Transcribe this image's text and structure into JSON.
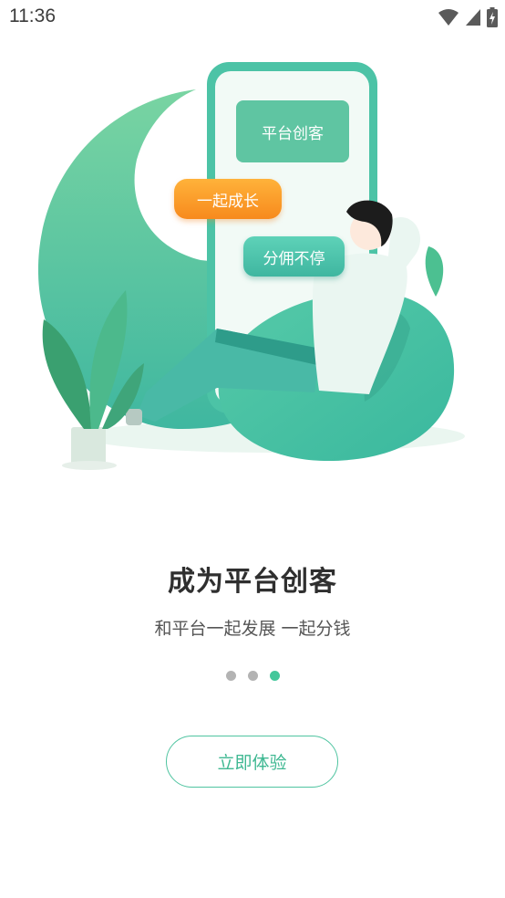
{
  "status_bar": {
    "time": "11:36"
  },
  "illustration": {
    "bubbles": [
      "平台创客",
      "一起成长",
      "分佣不停"
    ]
  },
  "content": {
    "title": "成为平台创客",
    "subtitle": "和平台一起发展 一起分钱"
  },
  "pager": {
    "total": 3,
    "active_index": 2
  },
  "cta": {
    "label": "立即体验"
  },
  "colors": {
    "accent": "#43c79b",
    "text_primary": "#2f2f2f",
    "dot_inactive": "#b3b3b3",
    "orange": "#f78a1d"
  }
}
